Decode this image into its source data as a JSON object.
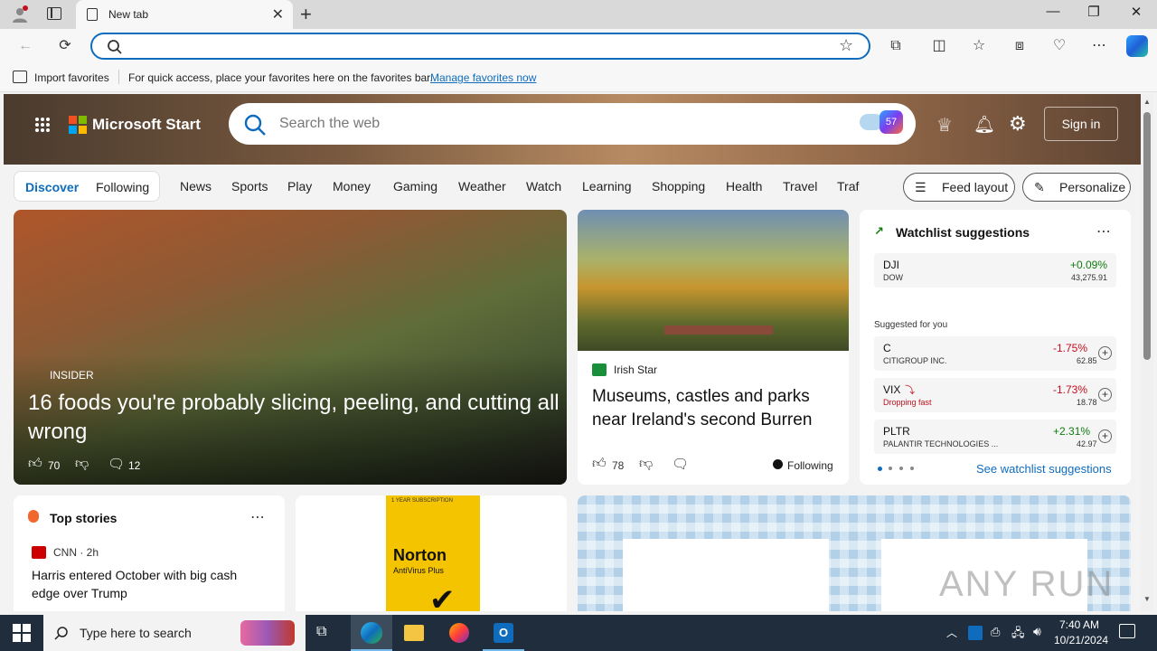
{
  "browser": {
    "tab_title": "New tab",
    "favorites_bar": {
      "import_label": "Import favorites",
      "message": "For quick access, place your favorites here on the favorites bar.",
      "manage_link": "Manage favorites now"
    }
  },
  "header": {
    "brand": "Microsoft Start",
    "search_placeholder": "Search the web",
    "signin_label": "Sign in"
  },
  "nav": {
    "pill": [
      "Discover",
      "Following"
    ],
    "items": [
      "News",
      "Sports",
      "Play",
      "Money",
      "Gaming",
      "Weather",
      "Watch",
      "Learning",
      "Shopping",
      "Health",
      "Travel",
      "Traf"
    ],
    "feed_layout": "Feed layout",
    "personalize": "Personalize"
  },
  "hero_card": {
    "source": "INSIDER",
    "headline": "16 foods you're probably slicing, peeling, and cutting all wrong",
    "likes": "70",
    "comments": "12"
  },
  "ireland_card": {
    "source": "Irish Star",
    "headline": "Museums, castles and parks near Ireland's second Burren",
    "likes": "78",
    "following": "Following"
  },
  "watchlist": {
    "title": "Watchlist suggestions",
    "primary": {
      "symbol": "DJI",
      "change": "+0.09%",
      "name": "DOW",
      "value": "43,275.91"
    },
    "suggested_label": "Suggested for you",
    "items": [
      {
        "symbol": "C",
        "change": "-1.75%",
        "name": "CITIGROUP INC.",
        "value": "62.85"
      },
      {
        "symbol": "VIX",
        "change": "-1.73%",
        "name": "Dropping fast",
        "value": "18.78"
      },
      {
        "symbol": "PLTR",
        "change": "+2.31%",
        "name": "PALANTIR TECHNOLOGIES ...",
        "value": "42.97"
      }
    ],
    "see_link": "See watchlist suggestions"
  },
  "top_stories": {
    "title": "Top stories",
    "source": "CNN · 2h",
    "headline": "Harris entered October with big cash edge over Trump"
  },
  "ad": {
    "brand": "Norton",
    "product": "AntiVirus Plus",
    "small": "1 YEAR SUBSCRIPTION"
  },
  "taskbar": {
    "search_placeholder": "Type here to search",
    "time": "7:40 AM",
    "date": "10/21/2024"
  },
  "watermark": "ANY RUN",
  "colors": {
    "accent": "#0f6cbd",
    "positive": "#107c10",
    "negative": "#c50f1f"
  }
}
